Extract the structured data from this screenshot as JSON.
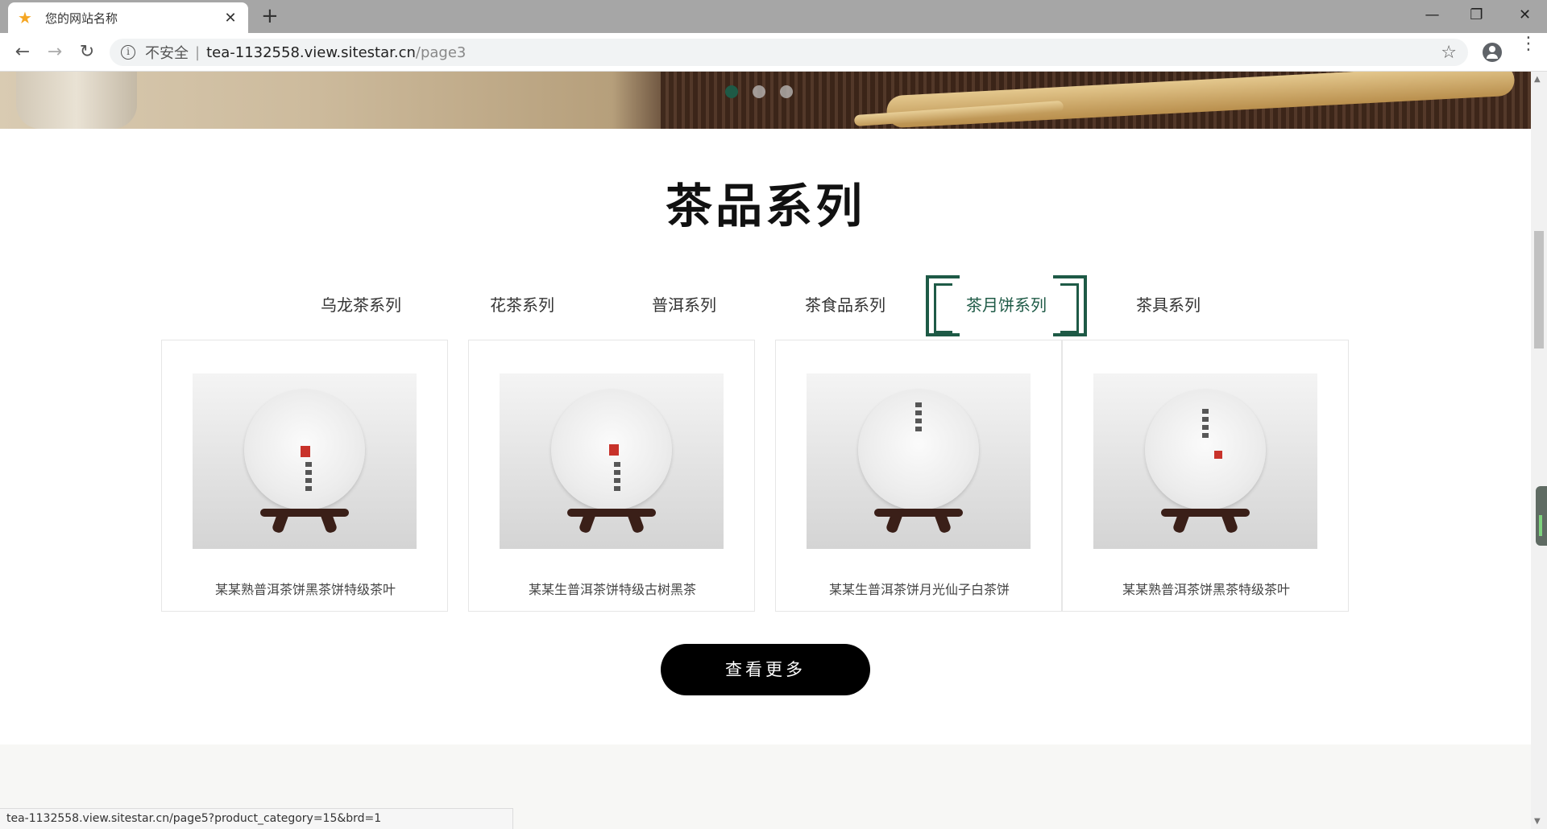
{
  "browser": {
    "tab_title": "您的网站名称",
    "tab_close": "✕",
    "new_tab": "+",
    "window_controls": {
      "minimize": "—",
      "restore": "❐",
      "close": "✕"
    },
    "nav": {
      "back": "←",
      "forward": "→",
      "reload": "↻"
    },
    "address": {
      "security_label": "不安全",
      "separator": "|",
      "host": "tea-1132558.view.sitestar.cn",
      "path": "/page3"
    },
    "bookmark_star": "☆",
    "menu": "⋮"
  },
  "banner": {
    "slides": 3,
    "active_slide": 1
  },
  "section": {
    "title": "茶品系列",
    "categories": [
      {
        "label": "乌龙茶系列",
        "active": false
      },
      {
        "label": "花茶系列",
        "active": false
      },
      {
        "label": "普洱系列",
        "active": false
      },
      {
        "label": "茶食品系列",
        "active": false
      },
      {
        "label": "茶月饼系列",
        "active": true
      },
      {
        "label": "茶具系列",
        "active": false
      }
    ],
    "accent_color": "#1e5a46"
  },
  "products": [
    {
      "name": "某某熟普洱茶饼黑茶饼特级茶叶"
    },
    {
      "name": "某某生普洱茶饼特级古树黑茶"
    },
    {
      "name": "某某生普洱茶饼月光仙子白茶饼"
    },
    {
      "name": "某某熟普洱茶饼黑茶特级茶叶"
    }
  ],
  "more_button": "查看更多",
  "status_url": "tea-1132558.view.sitestar.cn/page5?product_category=15&brd=1"
}
